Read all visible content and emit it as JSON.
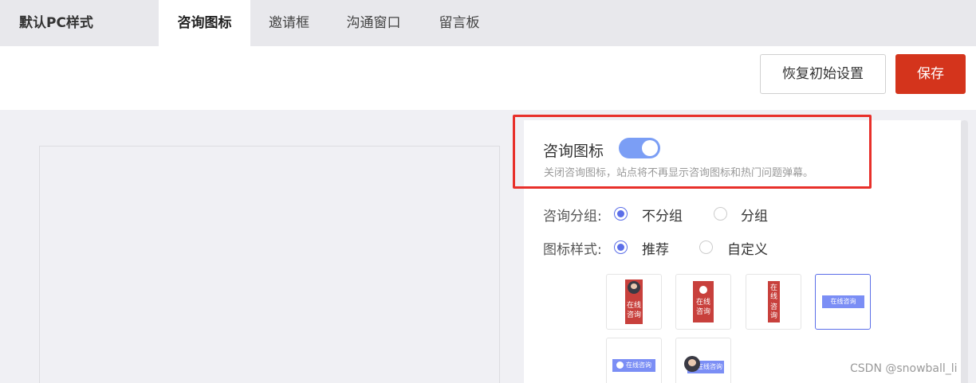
{
  "header": {
    "brand": "默认PC样式",
    "tabs": [
      {
        "label": "咨询图标",
        "active": true
      },
      {
        "label": "邀请框",
        "active": false
      },
      {
        "label": "沟通窗口",
        "active": false
      },
      {
        "label": "留言板",
        "active": false
      }
    ]
  },
  "toolbar": {
    "reset_label": "恢复初始设置",
    "save_label": "保存",
    "save_color": "#d4341c"
  },
  "panel": {
    "section_title": "咨询图标",
    "toggle_on": true,
    "toggle_color": "#7b9ef5",
    "description": "关闭咨询图标，站点将不再显示咨询图标和热门问题弹幕。",
    "group_row": {
      "label": "咨询分组:",
      "options": [
        {
          "label": "不分组",
          "checked": true
        },
        {
          "label": "分组",
          "checked": false
        }
      ]
    },
    "style_row": {
      "label": "图标样式:",
      "options": [
        {
          "label": "推荐",
          "checked": true
        },
        {
          "label": "自定义",
          "checked": false
        }
      ]
    },
    "icon_styles": [
      {
        "icon": "avatar-icon",
        "text_line1": "在线",
        "text_line2": "咨询",
        "selected": false
      },
      {
        "icon": "chat-bubble-icon",
        "text_line1": "在线",
        "text_line2": "咨询",
        "selected": false
      },
      {
        "icon": "none",
        "text_line1": "在线",
        "text_line2": "咨询",
        "selected": false
      },
      {
        "icon": "none",
        "text": "在线咨询",
        "selected": true
      },
      {
        "icon": "chat-bubble-icon",
        "text": "在线咨询",
        "selected": false
      },
      {
        "icon": "avatar-icon",
        "text": "在线咨询",
        "selected": false
      }
    ]
  },
  "watermark": "CSDN @snowball_li"
}
